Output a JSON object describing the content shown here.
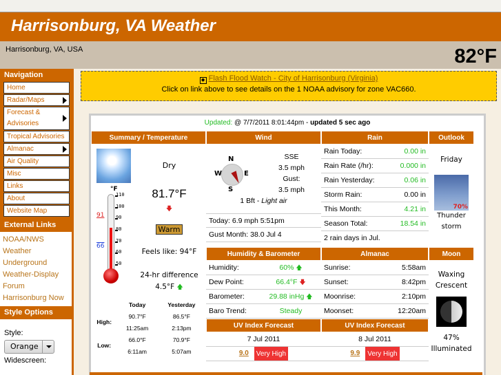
{
  "header": {
    "title": "Harrisonburg, VA Weather",
    "location": "Harrisonburg, VA, USA",
    "current_temp": "82°F"
  },
  "sidebar": {
    "nav_title": "Navigation",
    "nav_items": [
      {
        "label": "Home",
        "submenu": false
      },
      {
        "label": "Radar/Maps",
        "submenu": true
      },
      {
        "label": "Forecast & Advisories",
        "submenu": true
      },
      {
        "label": "Tropical Advisories",
        "submenu": false
      },
      {
        "label": "Almanac",
        "submenu": true
      },
      {
        "label": "Air Quality",
        "submenu": false
      },
      {
        "label": "Misc",
        "submenu": false
      },
      {
        "label": "Links",
        "submenu": false
      },
      {
        "label": "About",
        "submenu": false
      },
      {
        "label": "Website Map",
        "submenu": false
      }
    ],
    "external_title": "External Links",
    "external_links": [
      "NOAA/NWS",
      "Weather Underground",
      "Weather-Display Forum",
      "Harrisonburg Now"
    ],
    "style_title": "Style Options",
    "style_label": "Style:",
    "style_value": "Orange",
    "widescreen_label": "Widescreen:"
  },
  "alert": {
    "link": "Flash Flood Watch - City of Harrisonburg (Virginia)",
    "text": "Click on link above to see details on the 1 NOAA advisory for zone VAC660."
  },
  "updated": {
    "label": "Updated:",
    "time": "@ 7/7/2011 8:01:44pm",
    "sep": " - ",
    "ago": "updated 5 sec ago"
  },
  "summary": {
    "title": "Summary / Temperature",
    "condition": "Dry",
    "temp": "81.7°F",
    "badge": "Warm",
    "feels_like": "Feels like: 94°F",
    "diff_label": "24-hr difference",
    "diff_value": "4.5°F",
    "therm_unit": "°F",
    "therm_ticks": [
      "110",
      "100",
      "90",
      "80",
      "70",
      "60",
      "50"
    ],
    "therm_high": "91",
    "therm_low": "66",
    "therm_current": 81.7,
    "col_today": "Today",
    "col_yesterday": "Yesterday",
    "high_label": "High:",
    "low_label": "Low:",
    "high_today": "90.7°F",
    "high_today_time": "11:25am",
    "high_yest": "86.5°F",
    "high_yest_time": "2:13pm",
    "low_today": "66.0°F",
    "low_today_time": "6:11am",
    "low_yest": "70.9°F",
    "low_yest_time": "5:07am"
  },
  "wind": {
    "title": "Wind",
    "compass": {
      "n": "N",
      "s": "S",
      "e": "E",
      "w": "W"
    },
    "direction": "SSE",
    "speed": "3.5 mph",
    "gust_label": "Gust:",
    "gust": "3.5 mph",
    "bft": "1 Bft - ",
    "bft_desc": "Light air",
    "today": "Today: 6.9 mph 5:51pm",
    "gust_month": "Gust Month: 38.0 Jul 4"
  },
  "rain": {
    "title": "Rain",
    "rows": [
      {
        "label": "Rain Today:",
        "value": "0.00 in",
        "color": "green"
      },
      {
        "label": "Rain Rate (/hr):",
        "value": "0.000 in",
        "color": "green"
      },
      {
        "label": "Rain Yesterday:",
        "value": "0.06 in",
        "color": "green"
      },
      {
        "label": "Storm Rain:",
        "value": "0.00 in",
        "color": "black"
      },
      {
        "label": "This Month:",
        "value": "4.21 in",
        "color": "green"
      },
      {
        "label": "Season Total:",
        "value": "18.54 in",
        "color": "green"
      }
    ],
    "days": "2 rain days in Jul."
  },
  "outlook": {
    "title": "Outlook",
    "day": "Friday",
    "pop": "70%",
    "cond1": "Thunder",
    "cond2": "storm"
  },
  "humidity": {
    "title": "Humidity & Barometer",
    "rows": [
      {
        "label": "Humidity:",
        "value": "60%",
        "trend": "up"
      },
      {
        "label": "Dew Point:",
        "value": "66.4°F",
        "trend": "down"
      },
      {
        "label": "Barometer:",
        "value": "29.88 inHg",
        "trend": "up"
      },
      {
        "label": "Baro Trend:",
        "value": "Steady",
        "trend": ""
      }
    ]
  },
  "almanac": {
    "title": "Almanac",
    "rows": [
      {
        "label": "Sunrise:",
        "value": "5:58am"
      },
      {
        "label": "Sunset:",
        "value": "8:42pm"
      },
      {
        "label": "Moonrise:",
        "value": "2:10pm"
      },
      {
        "label": "Moonset:",
        "value": "12:20am"
      }
    ]
  },
  "moon": {
    "title": "Moon",
    "phase1": "Waxing",
    "phase2": "Crescent",
    "pct": "47%",
    "illum": "Illuminated"
  },
  "uv": [
    {
      "title": "UV Index Forecast",
      "date": "7 Jul 2011",
      "value": "9.0",
      "level": "Very High"
    },
    {
      "title": "UV Index Forecast",
      "date": "8 Jul 2011",
      "value": "9.9",
      "level": "Very High"
    }
  ]
}
